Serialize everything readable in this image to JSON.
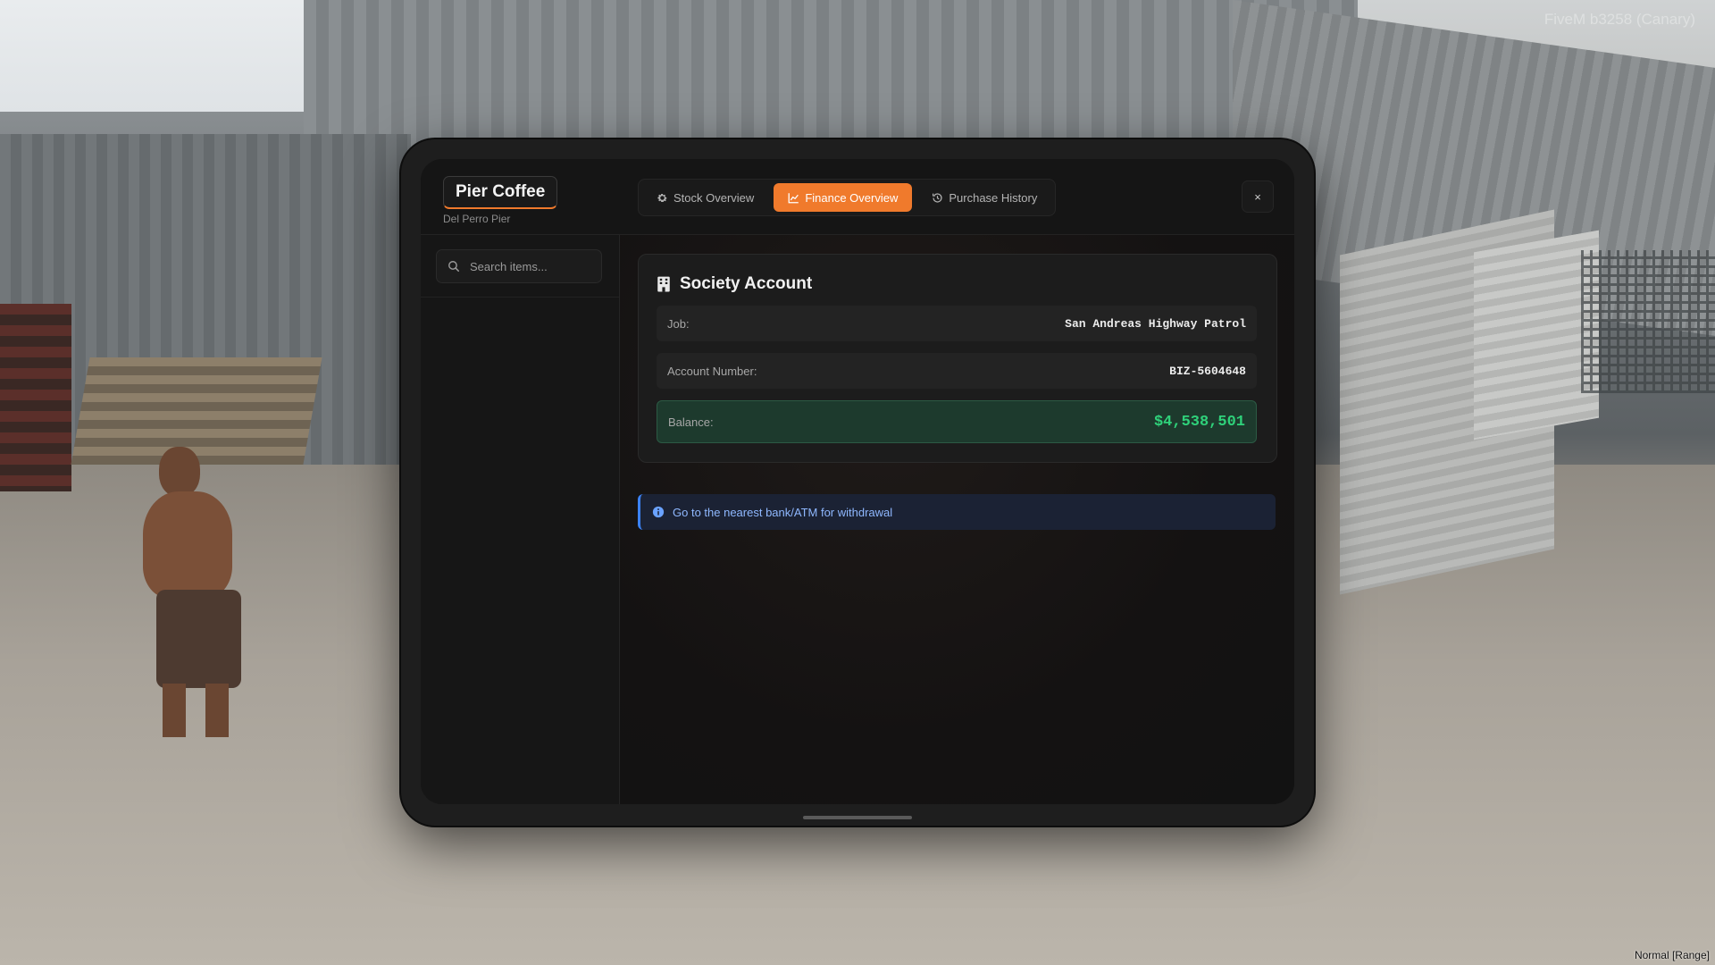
{
  "overlay": {
    "watermark": "FiveM b3258 (Canary)",
    "bottom_tag": "Normal [Range]"
  },
  "business": {
    "name": "Pier Coffee",
    "location": "Del Perro Pier"
  },
  "tabs": [
    {
      "label": "Stock Overview",
      "icon": "gear-icon",
      "active": false
    },
    {
      "label": "Finance Overview",
      "icon": "chart-line-icon",
      "active": true
    },
    {
      "label": "Purchase History",
      "icon": "history-icon",
      "active": false
    }
  ],
  "close": {
    "label": "×"
  },
  "search": {
    "placeholder": "Search items...",
    "value": ""
  },
  "society": {
    "title": "Society Account",
    "icon": "building-icon",
    "rows": [
      {
        "label": "Job:",
        "value": "San Andreas Highway Patrol"
      },
      {
        "label": "Account Number:",
        "value": "BIZ-5604648"
      },
      {
        "label": "Balance:",
        "value": "$4,538,501"
      }
    ]
  },
  "notice": {
    "icon": "info-icon",
    "text": "Go to the nearest bank/ATM for withdrawal"
  },
  "colors": {
    "accent": "#f07a2c",
    "balance_text": "#2fd17a",
    "info_text": "#8fb8ff",
    "info_border": "#3b82f6"
  }
}
